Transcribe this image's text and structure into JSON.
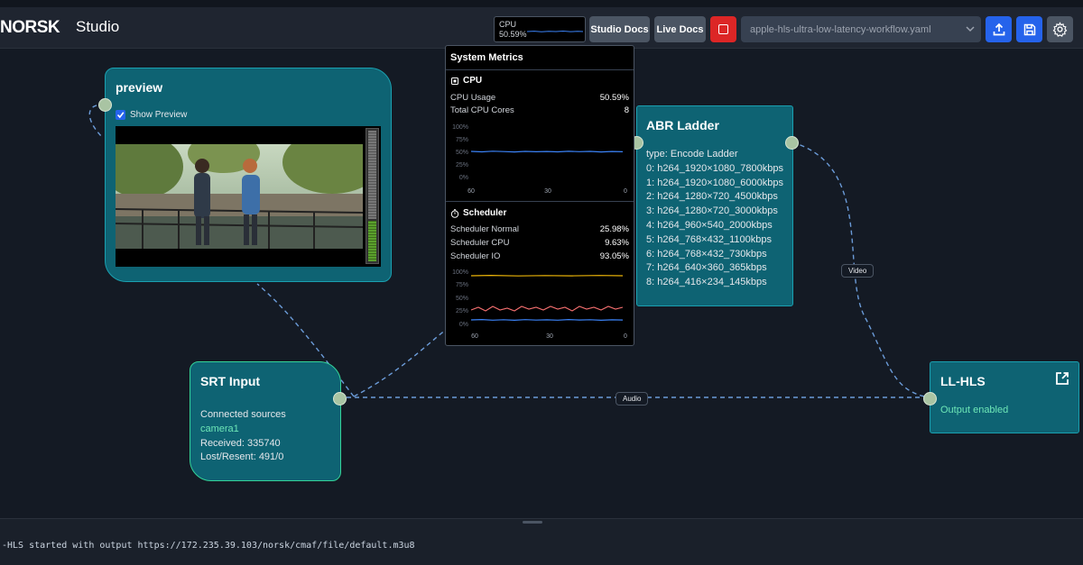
{
  "app": {
    "logo": "NORSK",
    "title": "Studio"
  },
  "header": {
    "cpu_label": "CPU",
    "cpu_value": "50.59%",
    "studio_docs": "Studio Docs",
    "live_docs": "Live Docs",
    "workflow": "apple-hls-ultra-low-latency-workflow.yaml",
    "colors": {
      "primary": "#2563eb",
      "stop": "#dc2626",
      "neutral": "#4b5563"
    },
    "icons": [
      "stop-icon",
      "upload-icon",
      "save-icon",
      "gear-icon"
    ]
  },
  "nodes": {
    "preview": {
      "title": "preview",
      "show_preview": "Show Preview"
    },
    "srt": {
      "title": "SRT Input",
      "connected_label": "Connected sources",
      "source": "camera1",
      "received": "Received: 335740",
      "lost": "Lost/Resent: 491/0"
    },
    "abr": {
      "title": "ABR Ladder",
      "type": "type: Encode Ladder",
      "rungs": [
        "0: h264_1920×1080_7800kbps",
        "1: h264_1920×1080_6000kbps",
        "2: h264_1280×720_4500kbps",
        "3: h264_1280×720_3000kbps",
        "4: h264_960×540_2000kbps",
        "5: h264_768×432_1100kbps",
        "6: h264_768×432_730kbps",
        "7: h264_640×360_365kbps",
        "8: h264_416×234_145kbps"
      ]
    },
    "llhls": {
      "title": "LL-HLS",
      "status": "Output enabled"
    },
    "colors": {
      "node_bg": "#0e6373",
      "port": "#a9c4a3",
      "edge": "#6b9bd8",
      "srt_border": "#34d399"
    }
  },
  "edges": {
    "video_label": "Video",
    "audio_label": "Audio"
  },
  "metrics": {
    "title": "System Metrics",
    "cpu": {
      "title": "CPU",
      "usage_label": "CPU Usage",
      "usage_value": "50.59%",
      "cores_label": "Total CPU Cores",
      "cores_value": "8"
    },
    "scheduler": {
      "title": "Scheduler",
      "normal_label": "Scheduler Normal",
      "normal_value": "25.98%",
      "cpu_label": "Scheduler CPU",
      "cpu_value": "9.63%",
      "io_label": "Scheduler IO",
      "io_value": "93.05%"
    },
    "y_ticks": [
      "100%",
      "75%",
      "50%",
      "25%",
      "0%"
    ],
    "x_ticks": [
      "60",
      "30",
      "0"
    ]
  },
  "console": {
    "log": "-HLS started with output https://172.235.39.103/norsk/cmaf/file/default.m3u8"
  }
}
